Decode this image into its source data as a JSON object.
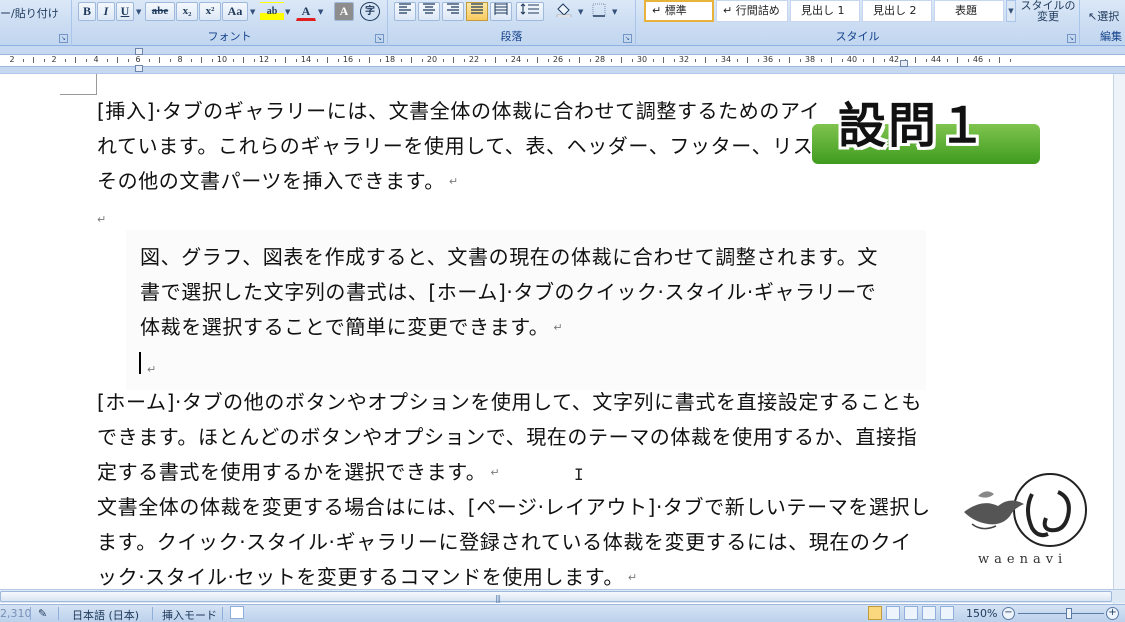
{
  "ribbon": {
    "clipboard_label": "ー/貼り付け",
    "font_group_label": "フォント",
    "paragraph_group_label": "段落",
    "styles_group_label": "スタイル",
    "editing_group_label": "編集",
    "bold": "B",
    "italic": "I",
    "underline": "U",
    "strikethrough": "abe",
    "subscript": "x₂",
    "superscript": "x²",
    "change_case": "Aa",
    "highlight": "ab",
    "font_color": "A",
    "char_shading": "A",
    "enclose": "字",
    "styles": [
      {
        "label": "↵ 標準",
        "selected": true
      },
      {
        "label": "↵ 行間詰め",
        "selected": false
      },
      {
        "label": "見出し 1",
        "selected": false
      },
      {
        "label": "見出し 2",
        "selected": false
      },
      {
        "label": "表題",
        "selected": false
      }
    ],
    "change_styles": "スタイルの\n変更",
    "select_label": "選択"
  },
  "ruler": {
    "numbers": [
      "2",
      "2",
      "4",
      "6",
      "8",
      "10",
      "12",
      "14",
      "16",
      "18",
      "20",
      "22",
      "24",
      "26",
      "28",
      "30",
      "32",
      "34",
      "36",
      "38",
      "40",
      "42",
      "44",
      "46"
    ]
  },
  "document": {
    "para1": [
      "[挿入]·タブのギャラリーには、文書全体の体裁に合わせて調整するためのアイ",
      "れています。これらのギャラリーを使用して、表、ヘッダー、フッター、リスト、表紙や、",
      "その他の文書パーツを挿入できます。"
    ],
    "empty_mark": "↵",
    "textbox": [
      "図、グラフ、図表を作成すると、文書の現在の体裁に合わせて調整されます。文",
      "書で選択した文字列の書式は、[ホーム]·タブのクイック·スタイル·ギャラリーで",
      "体裁を選択することで簡単に変更できます。"
    ],
    "para2": [
      "[ホーム]·タブの他のボタンやオプションを使用して、文字列に書式を直接設定することも",
      "できます。ほとんどのボタンやオプションで、現在のテーマの体裁を使用するか、直接指",
      "定する書式を使用するかを選択できます。"
    ],
    "para3": [
      "文書全体の体裁を変更する場合はには、[ページ·レイアウト]·タブで新しいテーマを選択し",
      "ます。クイック·スタイル·ギャラリーに登録されている体裁を変更するには、現在のクイ",
      "ック·スタイル·セットを変更するコマンドを使用します。"
    ]
  },
  "overlay": {
    "badge_text": "設問１",
    "badge_color": "#4ea52a",
    "logo_text": "waenavi"
  },
  "status": {
    "page_info": "2,310",
    "language": "日本語 (日本)",
    "mode": "挿入モード",
    "zoom": "150%"
  }
}
